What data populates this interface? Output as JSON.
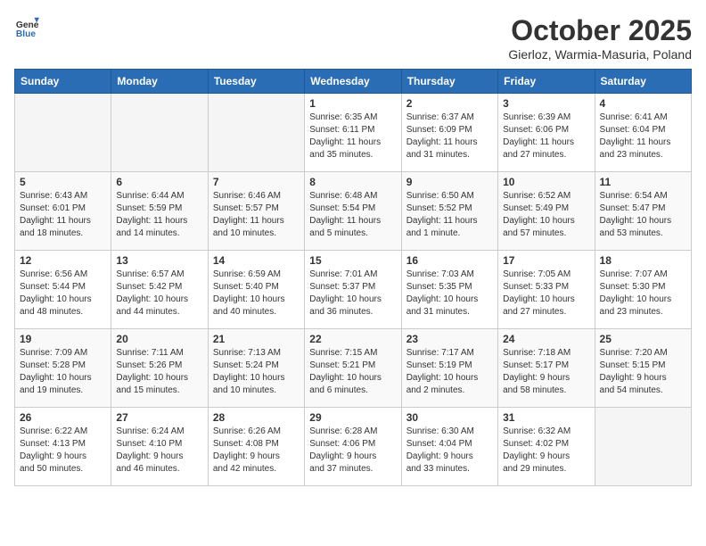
{
  "logo": {
    "general": "General",
    "blue": "Blue"
  },
  "title": "October 2025",
  "location": "Gierloz, Warmia-Masuria, Poland",
  "weekdays": [
    "Sunday",
    "Monday",
    "Tuesday",
    "Wednesday",
    "Thursday",
    "Friday",
    "Saturday"
  ],
  "weeks": [
    [
      {
        "day": "",
        "info": ""
      },
      {
        "day": "",
        "info": ""
      },
      {
        "day": "",
        "info": ""
      },
      {
        "day": "1",
        "info": "Sunrise: 6:35 AM\nSunset: 6:11 PM\nDaylight: 11 hours\nand 35 minutes."
      },
      {
        "day": "2",
        "info": "Sunrise: 6:37 AM\nSunset: 6:09 PM\nDaylight: 11 hours\nand 31 minutes."
      },
      {
        "day": "3",
        "info": "Sunrise: 6:39 AM\nSunset: 6:06 PM\nDaylight: 11 hours\nand 27 minutes."
      },
      {
        "day": "4",
        "info": "Sunrise: 6:41 AM\nSunset: 6:04 PM\nDaylight: 11 hours\nand 23 minutes."
      }
    ],
    [
      {
        "day": "5",
        "info": "Sunrise: 6:43 AM\nSunset: 6:01 PM\nDaylight: 11 hours\nand 18 minutes."
      },
      {
        "day": "6",
        "info": "Sunrise: 6:44 AM\nSunset: 5:59 PM\nDaylight: 11 hours\nand 14 minutes."
      },
      {
        "day": "7",
        "info": "Sunrise: 6:46 AM\nSunset: 5:57 PM\nDaylight: 11 hours\nand 10 minutes."
      },
      {
        "day": "8",
        "info": "Sunrise: 6:48 AM\nSunset: 5:54 PM\nDaylight: 11 hours\nand 5 minutes."
      },
      {
        "day": "9",
        "info": "Sunrise: 6:50 AM\nSunset: 5:52 PM\nDaylight: 11 hours\nand 1 minute."
      },
      {
        "day": "10",
        "info": "Sunrise: 6:52 AM\nSunset: 5:49 PM\nDaylight: 10 hours\nand 57 minutes."
      },
      {
        "day": "11",
        "info": "Sunrise: 6:54 AM\nSunset: 5:47 PM\nDaylight: 10 hours\nand 53 minutes."
      }
    ],
    [
      {
        "day": "12",
        "info": "Sunrise: 6:56 AM\nSunset: 5:44 PM\nDaylight: 10 hours\nand 48 minutes."
      },
      {
        "day": "13",
        "info": "Sunrise: 6:57 AM\nSunset: 5:42 PM\nDaylight: 10 hours\nand 44 minutes."
      },
      {
        "day": "14",
        "info": "Sunrise: 6:59 AM\nSunset: 5:40 PM\nDaylight: 10 hours\nand 40 minutes."
      },
      {
        "day": "15",
        "info": "Sunrise: 7:01 AM\nSunset: 5:37 PM\nDaylight: 10 hours\nand 36 minutes."
      },
      {
        "day": "16",
        "info": "Sunrise: 7:03 AM\nSunset: 5:35 PM\nDaylight: 10 hours\nand 31 minutes."
      },
      {
        "day": "17",
        "info": "Sunrise: 7:05 AM\nSunset: 5:33 PM\nDaylight: 10 hours\nand 27 minutes."
      },
      {
        "day": "18",
        "info": "Sunrise: 7:07 AM\nSunset: 5:30 PM\nDaylight: 10 hours\nand 23 minutes."
      }
    ],
    [
      {
        "day": "19",
        "info": "Sunrise: 7:09 AM\nSunset: 5:28 PM\nDaylight: 10 hours\nand 19 minutes."
      },
      {
        "day": "20",
        "info": "Sunrise: 7:11 AM\nSunset: 5:26 PM\nDaylight: 10 hours\nand 15 minutes."
      },
      {
        "day": "21",
        "info": "Sunrise: 7:13 AM\nSunset: 5:24 PM\nDaylight: 10 hours\nand 10 minutes."
      },
      {
        "day": "22",
        "info": "Sunrise: 7:15 AM\nSunset: 5:21 PM\nDaylight: 10 hours\nand 6 minutes."
      },
      {
        "day": "23",
        "info": "Sunrise: 7:17 AM\nSunset: 5:19 PM\nDaylight: 10 hours\nand 2 minutes."
      },
      {
        "day": "24",
        "info": "Sunrise: 7:18 AM\nSunset: 5:17 PM\nDaylight: 9 hours\nand 58 minutes."
      },
      {
        "day": "25",
        "info": "Sunrise: 7:20 AM\nSunset: 5:15 PM\nDaylight: 9 hours\nand 54 minutes."
      }
    ],
    [
      {
        "day": "26",
        "info": "Sunrise: 6:22 AM\nSunset: 4:13 PM\nDaylight: 9 hours\nand 50 minutes."
      },
      {
        "day": "27",
        "info": "Sunrise: 6:24 AM\nSunset: 4:10 PM\nDaylight: 9 hours\nand 46 minutes."
      },
      {
        "day": "28",
        "info": "Sunrise: 6:26 AM\nSunset: 4:08 PM\nDaylight: 9 hours\nand 42 minutes."
      },
      {
        "day": "29",
        "info": "Sunrise: 6:28 AM\nSunset: 4:06 PM\nDaylight: 9 hours\nand 37 minutes."
      },
      {
        "day": "30",
        "info": "Sunrise: 6:30 AM\nSunset: 4:04 PM\nDaylight: 9 hours\nand 33 minutes."
      },
      {
        "day": "31",
        "info": "Sunrise: 6:32 AM\nSunset: 4:02 PM\nDaylight: 9 hours\nand 29 minutes."
      },
      {
        "day": "",
        "info": ""
      }
    ]
  ]
}
